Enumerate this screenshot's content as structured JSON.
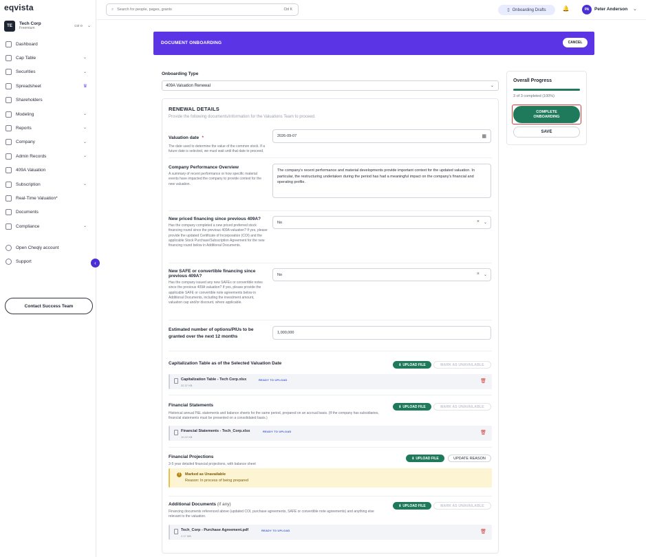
{
  "app": {
    "logo": "eqvista"
  },
  "org": {
    "initials": "TE",
    "name": "Tech Corp",
    "plan": "Freemium",
    "shortcut": "Ctrl O"
  },
  "nav": {
    "items": [
      {
        "label": "Dashboard",
        "icon": "dashboard-icon"
      },
      {
        "label": "Cap Table",
        "icon": "cap-table-icon",
        "chevron": true
      },
      {
        "label": "Securities",
        "icon": "securities-icon",
        "chevron": true
      },
      {
        "label": "Spreadsheet",
        "icon": "spreadsheet-icon",
        "crown": true
      },
      {
        "label": "Shareholders",
        "icon": "shareholders-icon"
      },
      {
        "label": "Modeling",
        "icon": "modeling-icon",
        "chevron": true
      },
      {
        "label": "Reports",
        "icon": "reports-icon",
        "chevron": true
      },
      {
        "label": "Company",
        "icon": "company-icon",
        "chevron": true
      },
      {
        "label": "Admin Records",
        "icon": "admin-records-icon",
        "chevron": true
      },
      {
        "label": "409A Valuation",
        "icon": "valuation-icon"
      },
      {
        "label": "Subscription",
        "icon": "subscription-icon",
        "chevron": true
      },
      {
        "label": "Real-Time Valuation*",
        "icon": "realtime-valuation-icon"
      },
      {
        "label": "Documents",
        "icon": "documents-icon"
      },
      {
        "label": "Compliance",
        "icon": "compliance-icon",
        "chevron": true
      }
    ],
    "extra": [
      {
        "label": "Open Cheqly account",
        "icon": "cheqly-icon"
      },
      {
        "label": "Support",
        "icon": "support-icon"
      }
    ],
    "contact_label": "Contact Success Team"
  },
  "topbar": {
    "search_placeholder": "Search for people, pages, grants",
    "search_shortcut": "Ctrl K",
    "drafts_label": "Onboarding Drafts",
    "user_initials": "PA",
    "user_name": "Peter Anderson"
  },
  "banner": {
    "title": "DOCUMENT ONBOARDING",
    "cancel_label": "CANCEL"
  },
  "form": {
    "onboarding_type_label": "Onboarding Type",
    "onboarding_type_value": "409A Valuation Renewal",
    "section_title": "RENEWAL DETAILS",
    "section_subtitle": "Provide the following documents/information for the Valuations Team to proceed.",
    "valuation_date": {
      "label": "Valuation date",
      "required_mark": "*",
      "help": "The date used to determine the value of the common stock. If a future date is selected, we must wait until that date to proceed.",
      "value": "2026-09-07"
    },
    "performance": {
      "label": "Company Performance Overview",
      "help": "A summary of recent performance or how specific material events have impacted the company to provide context for the new valuation.",
      "value": "The company's recent performance and material developments provide important context for the updated valuation. In particular, the restructuring undertaken during the period has had a meaningful impact on the company's financial and operating profile."
    },
    "priced_financing": {
      "label": "New priced financing since previous 409A?",
      "help": "Has the company completed a new priced preferred stock financing round since the previous 409A valuation? If yes, please provide the updated Certificate of Incorporation (COI) and the applicable Stock Purchase/Subscription Agreement for the new financing round below in Additional Documents.",
      "value": "No"
    },
    "safe_financing": {
      "label": "New SAFE or convertible financing since previous 409A?",
      "help": "Has the company issued any new SAFEs or convertible notes since the previous 409A valuation? If yes, please provide the applicable SAFE or convertible note agreements below in Additional Documents, including the investment amount, valuation cap and/or discount, where applicable.",
      "value": "No"
    },
    "options": {
      "label": "Estimated number of options/PIUs to be granted over the next 12 months",
      "value": "1,000,000"
    }
  },
  "documents": {
    "upload_label": "UPLOAD FILE",
    "mark_label": "MARK AS UNAVAILABLE",
    "cap_table": {
      "title": "Capitalization Table as of the Selected Valuation Date",
      "file_name": "Capitalization Table - Tech Corp.xlsx",
      "file_size": "32.37 KB",
      "status": "READY TO UPLOAD"
    },
    "financial_statements": {
      "title": "Financial Statements",
      "help": "Historical annual P&L statements and balance sheets for the same period, prepared on an accrual basis. (If the company has subsidiaries, financial statements must be presented on a consolidated basis.)",
      "file_name": "Financial Statements - Tech_Corp.xlsx",
      "file_size": "10.22 KB",
      "status": "READY TO UPLOAD"
    },
    "projections": {
      "title": "Financial Projections",
      "help": "3-5 year detailed financial projections, with balance sheet",
      "update_label": "UPDATE REASON",
      "unavailable_title": "Marked as Unavailable",
      "unavailable_reason": "Reason: In process of being prepared"
    },
    "additional": {
      "title": "Additional Documents",
      "title_suffix": "(if any)",
      "help": "Financing documents referenced above (updated COI, purchase agreements, SAFE or convertible note agreements) and anything else relevant to the valuation.",
      "file_name": "Tech_Corp - Purchase Agreement.pdf",
      "file_size": "2.17 MB",
      "status": "READY TO UPLOAD"
    }
  },
  "progress": {
    "title": "Overall Progress",
    "completed": 3,
    "total": 3,
    "text": "3 of 3 completed (100%)",
    "complete_label": "COMPLETE ONBOARDING",
    "save_label": "SAVE"
  },
  "colors": {
    "brand_purple": "#5b34e5",
    "success_green": "#1e7a5b",
    "warning_bg": "#fdf4d3",
    "danger_red": "#d23b3b"
  }
}
